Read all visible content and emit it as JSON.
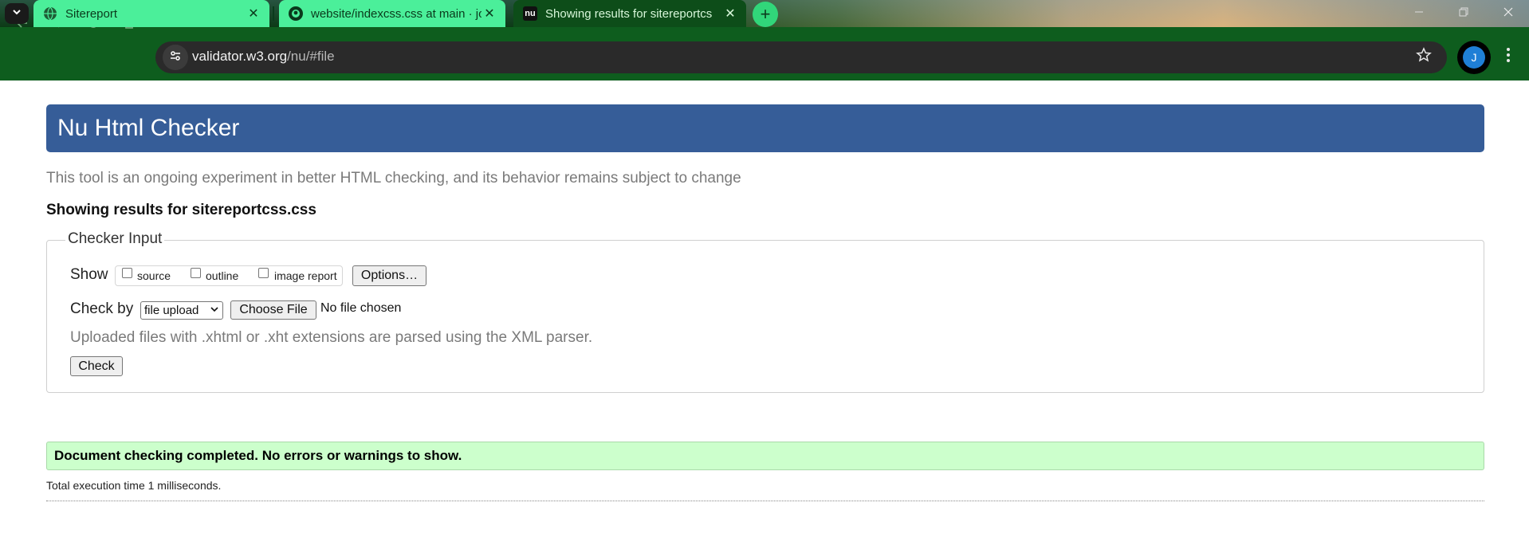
{
  "browser": {
    "tabs": [
      {
        "title": "Sitereport",
        "icon": "globe-icon"
      },
      {
        "title": "website/indexcss.css at main · jo",
        "icon": "github-icon"
      },
      {
        "title": "Showing results for sitereportcs",
        "icon": "nu-icon",
        "favicon_text": "nu",
        "active": true
      }
    ],
    "new_tab_symbol": "+",
    "address": {
      "host": "validator.w3.org",
      "path": "/nu/#file"
    },
    "profile_initial": "J",
    "colors": {
      "toolbar": "#0e5d1e",
      "active_tab": "#0d4d19",
      "inactive_tab": "#4bef9a"
    }
  },
  "page": {
    "header_title": "Nu Html Checker",
    "intro": "This tool is an ongoing experiment in better HTML checking, and its behavior remains subject to change",
    "results_heading": "Showing results for sitereportcss.css",
    "checker_input": {
      "legend": "Checker Input",
      "show_label": "Show",
      "checkboxes": [
        {
          "label": "source",
          "checked": false
        },
        {
          "label": "outline",
          "checked": false
        },
        {
          "label": "image report",
          "checked": false
        }
      ],
      "options_button": "Options…",
      "check_by_label": "Check by",
      "check_by_selected": "file upload",
      "choose_file_button": "Choose File",
      "file_status": "No file chosen",
      "hint": "Uploaded files with .xhtml or .xht extensions are parsed using the XML parser.",
      "check_button": "Check"
    },
    "result_message": "Document checking completed. No errors or warnings to show.",
    "execution_time": "Total execution time 1 milliseconds.",
    "colors": {
      "banner": "#365d98",
      "success_bg": "#ccffcc"
    }
  }
}
